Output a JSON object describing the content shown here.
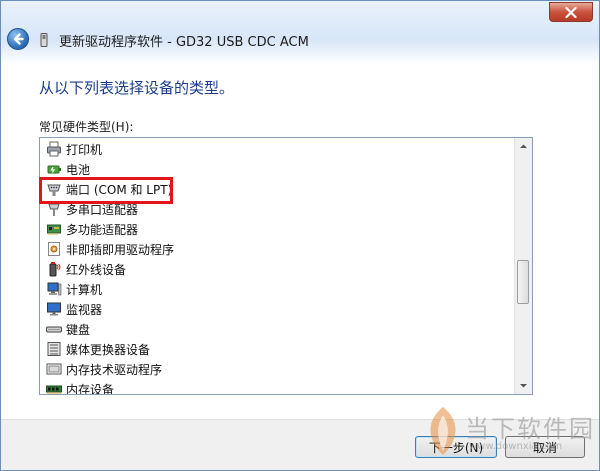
{
  "window": {
    "title": "更新驱动程序软件 - GD32 USB CDC ACM",
    "icons": {
      "back": "back-arrow-icon",
      "device": "device-icon",
      "close": "close-icon"
    }
  },
  "page": {
    "heading": "从以下列表选择设备的类型。",
    "list_label": "常见硬件类型(H):"
  },
  "hardware_types": [
    {
      "label": "打印机",
      "icon": "printer-icon"
    },
    {
      "label": "电池",
      "icon": "battery-icon"
    },
    {
      "label": "端口 (COM 和 LPT)",
      "icon": "port-icon"
    },
    {
      "label": "多串口适配器",
      "icon": "multiport-adapter-icon"
    },
    {
      "label": "多功能适配器",
      "icon": "multifunction-adapter-icon"
    },
    {
      "label": "非即插即用驱动程序",
      "icon": "non-pnp-driver-icon"
    },
    {
      "label": "红外线设备",
      "icon": "infrared-device-icon"
    },
    {
      "label": "计算机",
      "icon": "computer-icon"
    },
    {
      "label": "监视器",
      "icon": "monitor-icon"
    },
    {
      "label": "键盘",
      "icon": "keyboard-icon"
    },
    {
      "label": "媒体更换器设备",
      "icon": "media-changer-icon"
    },
    {
      "label": "内存技术驱动程序",
      "icon": "memory-technology-driver-icon"
    },
    {
      "label": "内存设备",
      "icon": "memory-device-icon"
    }
  ],
  "buttons": {
    "next": "下一步(N)",
    "cancel": "取消"
  },
  "watermark": {
    "name": "当下软件园",
    "url": "www.downxia.com"
  },
  "colors": {
    "heading": "#1a3d8c",
    "highlight_box": "#e4141b",
    "footer": "#f0f0f0"
  }
}
